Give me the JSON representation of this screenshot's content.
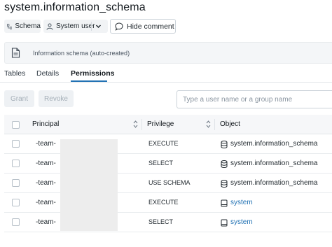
{
  "page": {
    "title": "system.information_schema"
  },
  "toolbar": {
    "schema_label": "Schema",
    "owner_label": "System user",
    "hide_comment_label": "Hide comment"
  },
  "comment": {
    "text": "Information schema (auto-created)"
  },
  "tabs": [
    {
      "label": "Tables",
      "active": false
    },
    {
      "label": "Details",
      "active": false
    },
    {
      "label": "Permissions",
      "active": true
    }
  ],
  "actions": {
    "grant_label": "Grant",
    "revoke_label": "Revoke",
    "search_placeholder": "Type a user name or a group name"
  },
  "table": {
    "columns": [
      "Principal",
      "Privilege",
      "Object"
    ],
    "rows": [
      {
        "principal": "-team-",
        "privilege": "EXECUTE",
        "object": "system.information_schema",
        "object_icon": "database-icon",
        "object_link": false
      },
      {
        "principal": "-team-",
        "privilege": "SELECT",
        "object": "system.information_schema",
        "object_icon": "database-icon",
        "object_link": false
      },
      {
        "principal": "-team-",
        "privilege": "USE SCHEMA",
        "object": "system.information_schema",
        "object_icon": "database-icon",
        "object_link": false
      },
      {
        "principal": "-team-",
        "privilege": "EXECUTE",
        "object": "system",
        "object_icon": "catalog-icon",
        "object_link": true
      },
      {
        "principal": "-team-",
        "privilege": "SELECT",
        "object": "system",
        "object_icon": "catalog-icon",
        "object_link": true
      }
    ]
  },
  "colors": {
    "link": "#2272b4",
    "tab_underline": "#2272b4",
    "disabled_button_bg": "#eef1f4",
    "redaction": "#ededed"
  }
}
